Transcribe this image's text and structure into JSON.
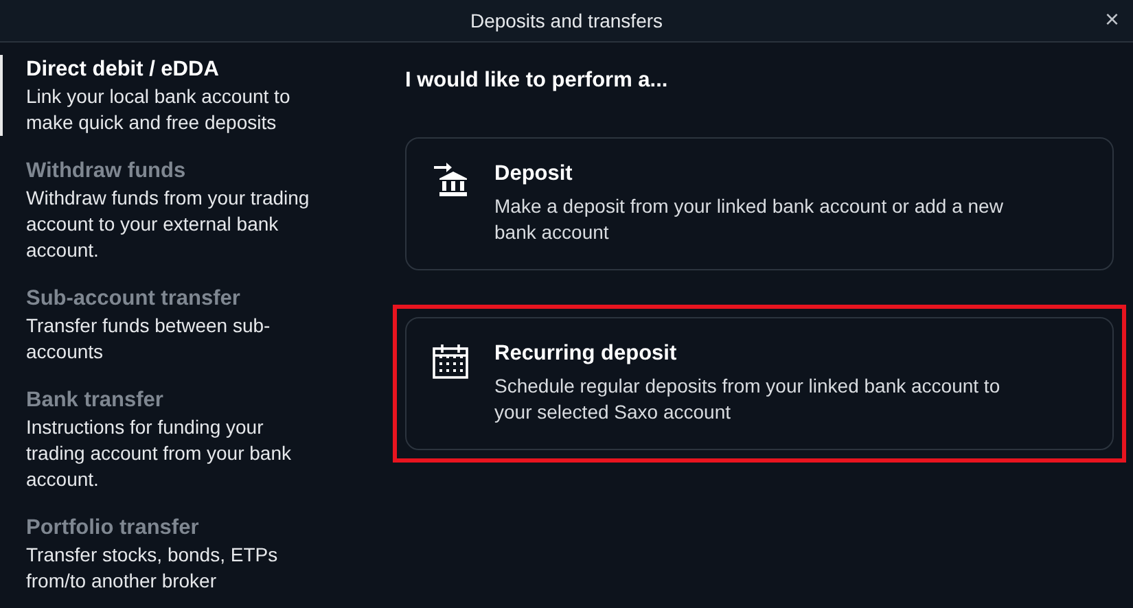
{
  "window": {
    "title": "Deposits and transfers",
    "close": "×"
  },
  "sidebar": {
    "items": [
      {
        "title": "Direct debit / eDDA",
        "description": "Link your local bank account to make quick and free deposits",
        "selected": true
      },
      {
        "title": "Withdraw funds",
        "description": "Withdraw funds from your trading account to your external bank account.",
        "selected": false
      },
      {
        "title": "Sub-account transfer",
        "description": "Transfer funds between sub-accounts",
        "selected": false
      },
      {
        "title": "Bank transfer",
        "description": "Instructions for funding your trading account from your bank account.",
        "selected": false
      },
      {
        "title": "Portfolio transfer",
        "description": "Transfer stocks, bonds, ETPs from/to another broker",
        "selected": false
      }
    ]
  },
  "main": {
    "heading": "I would like to perform a...",
    "options": [
      {
        "kind": "deposit",
        "title": "Deposit",
        "description": "Make a deposit from your linked bank account or add a new bank account",
        "highlighted": false
      },
      {
        "kind": "recurring",
        "title": "Recurring deposit",
        "description": "Schedule regular deposits from your linked bank account to your selected Saxo account",
        "highlighted": true
      }
    ]
  }
}
